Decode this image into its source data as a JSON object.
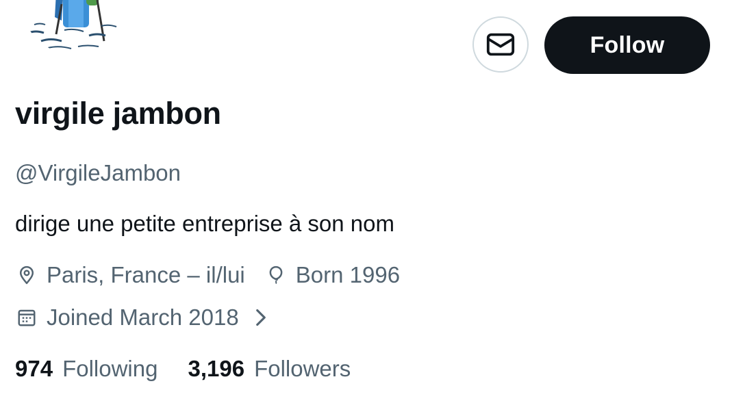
{
  "profile": {
    "display_name": "virgile jambon",
    "handle": "@VirgileJambon",
    "bio": "dirige une petite entreprise à son nom",
    "location": "Paris, France – il/lui",
    "born": "Born 1996",
    "joined": "Joined March 2018"
  },
  "actions": {
    "follow_label": "Follow",
    "message_icon": "mail-icon"
  },
  "stats": {
    "following_count": "974",
    "following_label": "Following",
    "followers_count": "3,196",
    "followers_label": "Followers"
  },
  "icons": {
    "location": "map-pin-icon",
    "birthday": "balloon-icon",
    "joined": "calendar-icon",
    "more": "chevron-right-icon"
  },
  "colors": {
    "primary_text": "#0f1419",
    "secondary_text": "#536471",
    "button_bg": "#0f1419",
    "border": "#cfd9de"
  }
}
